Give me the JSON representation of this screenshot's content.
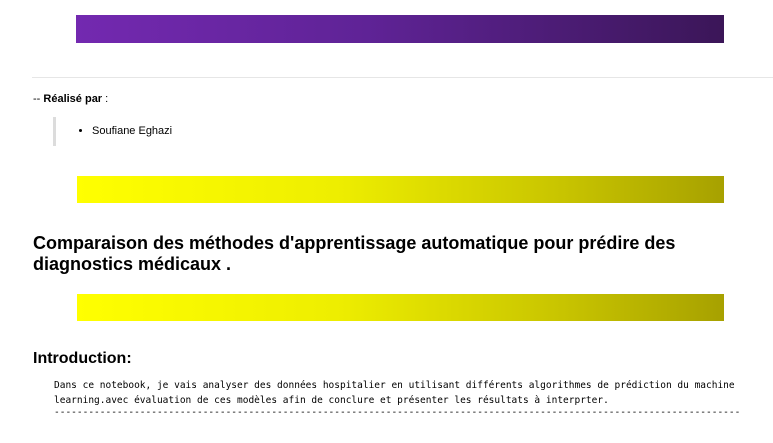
{
  "colors": {
    "banner_purple": "#6a26a8",
    "banner_yellow": "#ffff00"
  },
  "credits": {
    "prefix": "-- ",
    "label": "Réalisé par",
    "suffix": " :",
    "authors": [
      "Soufiane Eghazi"
    ]
  },
  "title": "Comparaison des méthodes d'apprentissage automatique pour prédire des diagnostics médicaux .",
  "introduction": {
    "heading": "Introduction:",
    "text": "Dans ce notebook, je vais analyser des données hospitalier en utilisant différents algorithmes de prédiction du machine learning.avec évaluation de ces modèles afin de conclure et présenter les résultats à interprter.",
    "separator": "------------------------------------------------------------------------------------------------------------------------"
  }
}
